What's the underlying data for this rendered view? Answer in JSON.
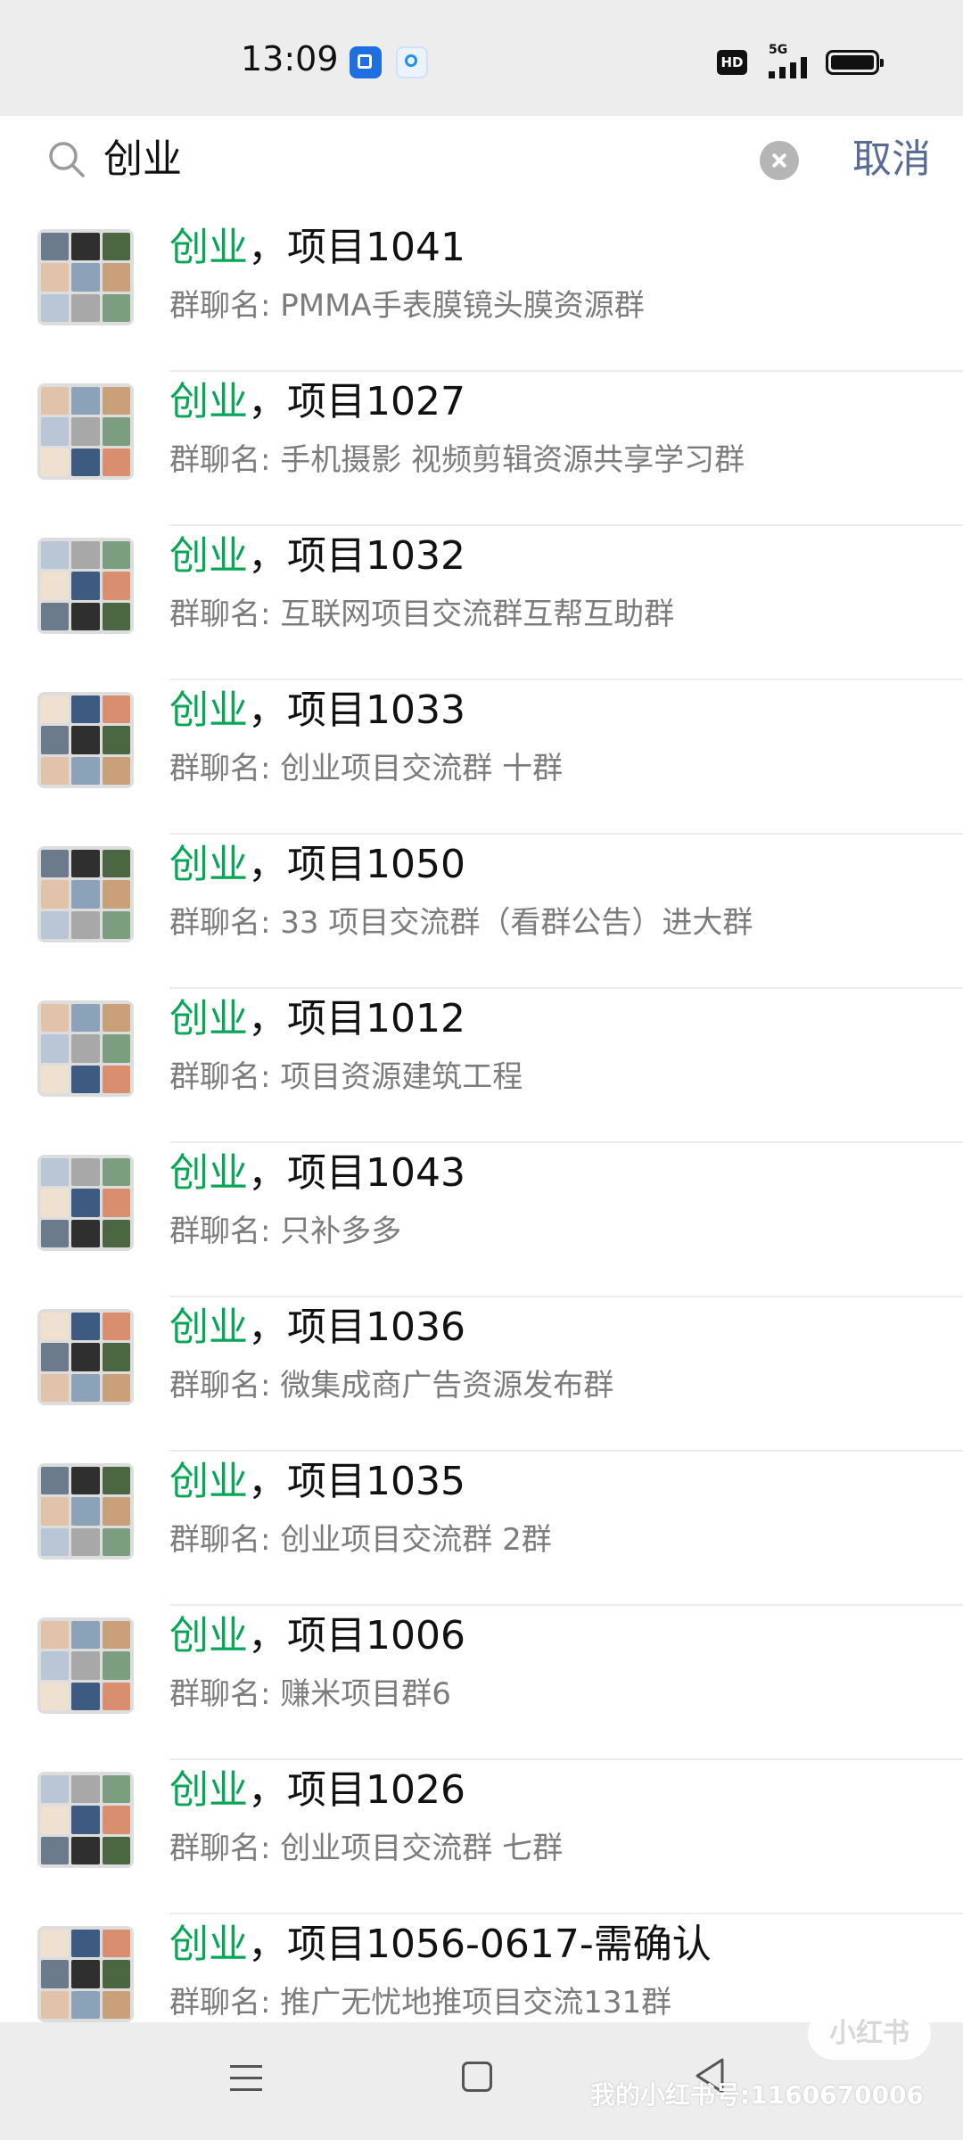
{
  "status_bar": {
    "time": "13:09",
    "hd_label": "HD",
    "network": "5G"
  },
  "search": {
    "query": "创业",
    "cancel_label": "取消"
  },
  "results": [
    {
      "keyword": "创业",
      "title_rest": "，项目1041",
      "subtitle": "群聊名: PMMA手表膜镜头膜资源群"
    },
    {
      "keyword": "创业",
      "title_rest": "，项目1027",
      "subtitle": "群聊名: 手机摄影 视频剪辑资源共享学习群"
    },
    {
      "keyword": "创业",
      "title_rest": "，项目1032",
      "subtitle": "群聊名: 互联网项目交流群互帮互助群"
    },
    {
      "keyword": "创业",
      "title_rest": "，项目1033",
      "subtitle": "群聊名: 创业项目交流群 十群"
    },
    {
      "keyword": "创业",
      "title_rest": "，项目1050",
      "subtitle": "群聊名: 33 项目交流群（看群公告）进大群"
    },
    {
      "keyword": "创业",
      "title_rest": "，项目1012",
      "subtitle": "群聊名: 项目资源建筑工程"
    },
    {
      "keyword": "创业",
      "title_rest": "，项目1043",
      "subtitle": "群聊名: 只补多多"
    },
    {
      "keyword": "创业",
      "title_rest": "，项目1036",
      "subtitle": "群聊名: 微集成商广告资源发布群"
    },
    {
      "keyword": "创业",
      "title_rest": "，项目1035",
      "subtitle": "群聊名: 创业项目交流群 2群"
    },
    {
      "keyword": "创业",
      "title_rest": "，项目1006",
      "subtitle": "群聊名: 赚米项目群6"
    },
    {
      "keyword": "创业",
      "title_rest": "，项目1026",
      "subtitle": "群聊名: 创业项目交流群 七群"
    },
    {
      "keyword": "创业",
      "title_rest": "，项目1056-0617-需确认",
      "subtitle": "群聊名: 推广无忧地推项目交流131群"
    }
  ],
  "watermark": {
    "badge": "小红书",
    "text": "我的小红书号:1160670006"
  },
  "colors": {
    "keyword_highlight": "#07a656",
    "cancel_link": "#576b95",
    "subtitle": "#7c7c7c",
    "status_bar_bg": "#ededed"
  }
}
